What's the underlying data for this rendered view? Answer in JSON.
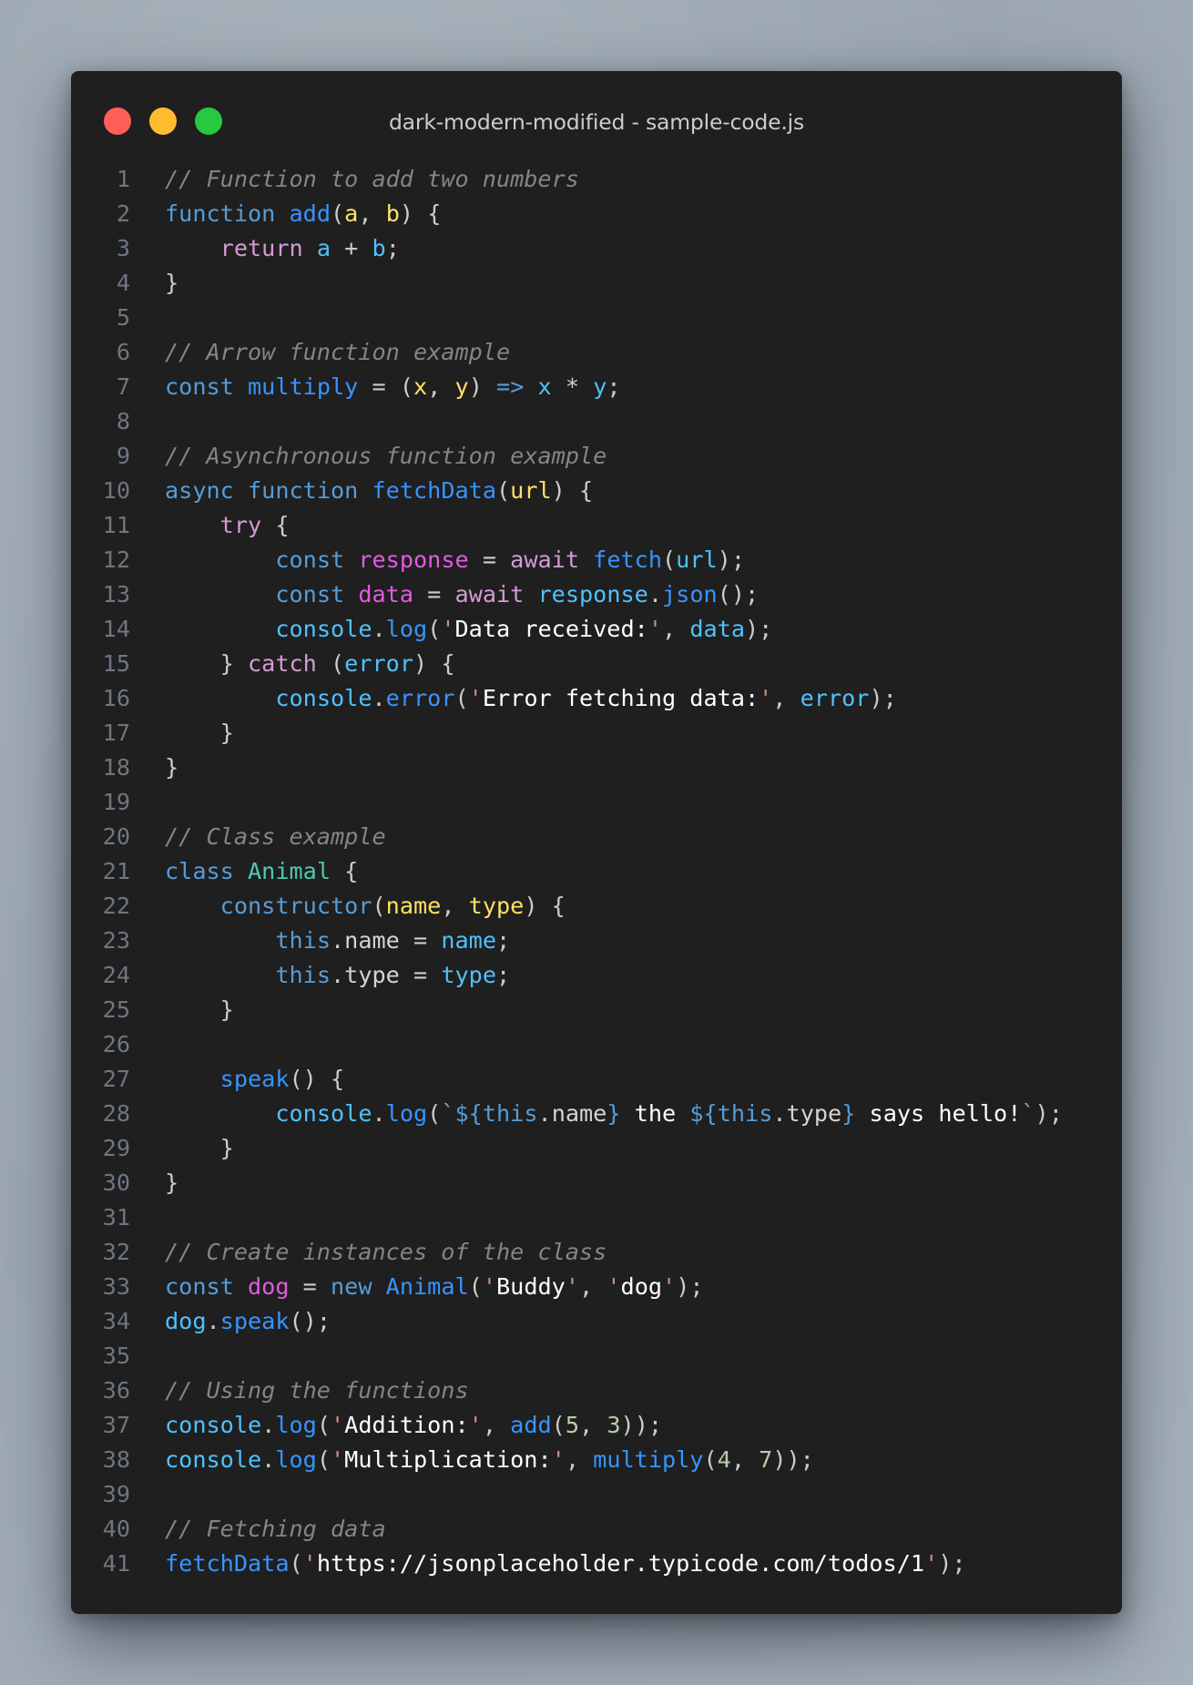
{
  "window": {
    "title": "dark-modern-modified - sample-code.js",
    "controls": [
      {
        "name": "close-button",
        "color": "#ff5f57"
      },
      {
        "name": "minimize-button",
        "color": "#febc2e"
      },
      {
        "name": "maximize-button",
        "color": "#28c840"
      }
    ]
  },
  "editor": {
    "language": "javascript",
    "lines": [
      {
        "n": "1",
        "tokens": [
          [
            "// Function to add two numbers",
            "comment"
          ]
        ]
      },
      {
        "n": "2",
        "tokens": [
          [
            "function",
            "keyword"
          ],
          [
            " ",
            "punct"
          ],
          [
            "add",
            "func"
          ],
          [
            "(",
            "punct"
          ],
          [
            "a",
            "param"
          ],
          [
            ", ",
            "punct"
          ],
          [
            "b",
            "param"
          ],
          [
            ") {",
            "punct"
          ]
        ]
      },
      {
        "n": "3",
        "tokens": [
          [
            "    ",
            "punct"
          ],
          [
            "return",
            "control"
          ],
          [
            " ",
            "punct"
          ],
          [
            "a",
            "var"
          ],
          [
            " + ",
            "punct"
          ],
          [
            "b",
            "var"
          ],
          [
            ";",
            "punct"
          ]
        ]
      },
      {
        "n": "4",
        "tokens": [
          [
            "}",
            "punct"
          ]
        ]
      },
      {
        "n": "5",
        "tokens": []
      },
      {
        "n": "6",
        "tokens": [
          [
            "// Arrow function example",
            "comment"
          ]
        ]
      },
      {
        "n": "7",
        "tokens": [
          [
            "const",
            "keyword"
          ],
          [
            " ",
            "punct"
          ],
          [
            "multiply",
            "func"
          ],
          [
            " = (",
            "punct"
          ],
          [
            "x",
            "param"
          ],
          [
            ", ",
            "punct"
          ],
          [
            "y",
            "param"
          ],
          [
            ") ",
            "punct"
          ],
          [
            "=>",
            "keyword"
          ],
          [
            " ",
            "punct"
          ],
          [
            "x",
            "var"
          ],
          [
            " * ",
            "punct"
          ],
          [
            "y",
            "var"
          ],
          [
            ";",
            "punct"
          ]
        ]
      },
      {
        "n": "8",
        "tokens": []
      },
      {
        "n": "9",
        "tokens": [
          [
            "// Asynchronous function example",
            "comment"
          ]
        ]
      },
      {
        "n": "10",
        "tokens": [
          [
            "async",
            "keyword"
          ],
          [
            " ",
            "punct"
          ],
          [
            "function",
            "keyword"
          ],
          [
            " ",
            "punct"
          ],
          [
            "fetchData",
            "func"
          ],
          [
            "(",
            "punct"
          ],
          [
            "url",
            "param"
          ],
          [
            ") {",
            "punct"
          ]
        ]
      },
      {
        "n": "11",
        "tokens": [
          [
            "    ",
            "punct"
          ],
          [
            "try",
            "control"
          ],
          [
            " {",
            "punct"
          ]
        ]
      },
      {
        "n": "12",
        "tokens": [
          [
            "        ",
            "punct"
          ],
          [
            "const",
            "keyword"
          ],
          [
            " ",
            "punct"
          ],
          [
            "response",
            "decl"
          ],
          [
            " = ",
            "punct"
          ],
          [
            "await",
            "control"
          ],
          [
            " ",
            "punct"
          ],
          [
            "fetch",
            "func"
          ],
          [
            "(",
            "punct"
          ],
          [
            "url",
            "var"
          ],
          [
            ");",
            "punct"
          ]
        ]
      },
      {
        "n": "13",
        "tokens": [
          [
            "        ",
            "punct"
          ],
          [
            "const",
            "keyword"
          ],
          [
            " ",
            "punct"
          ],
          [
            "data",
            "decl"
          ],
          [
            " = ",
            "punct"
          ],
          [
            "await",
            "control"
          ],
          [
            " ",
            "punct"
          ],
          [
            "response",
            "var"
          ],
          [
            ".",
            "punct"
          ],
          [
            "json",
            "func"
          ],
          [
            "();",
            "punct"
          ]
        ]
      },
      {
        "n": "14",
        "tokens": [
          [
            "        ",
            "punct"
          ],
          [
            "console",
            "var"
          ],
          [
            ".",
            "punct"
          ],
          [
            "log",
            "func"
          ],
          [
            "(",
            "punct"
          ],
          [
            "'",
            "quote"
          ],
          [
            "Data received:",
            "string"
          ],
          [
            "'",
            "quote"
          ],
          [
            ", ",
            "punct"
          ],
          [
            "data",
            "var"
          ],
          [
            ");",
            "punct"
          ]
        ]
      },
      {
        "n": "15",
        "tokens": [
          [
            "    } ",
            "punct"
          ],
          [
            "catch",
            "control"
          ],
          [
            " (",
            "punct"
          ],
          [
            "error",
            "var"
          ],
          [
            ") {",
            "punct"
          ]
        ]
      },
      {
        "n": "16",
        "tokens": [
          [
            "        ",
            "punct"
          ],
          [
            "console",
            "var"
          ],
          [
            ".",
            "punct"
          ],
          [
            "error",
            "func"
          ],
          [
            "(",
            "punct"
          ],
          [
            "'",
            "quote"
          ],
          [
            "Error fetching data:",
            "string"
          ],
          [
            "'",
            "quote"
          ],
          [
            ", ",
            "punct"
          ],
          [
            "error",
            "var"
          ],
          [
            ");",
            "punct"
          ]
        ]
      },
      {
        "n": "17",
        "tokens": [
          [
            "    }",
            "punct"
          ]
        ]
      },
      {
        "n": "18",
        "tokens": [
          [
            "}",
            "punct"
          ]
        ]
      },
      {
        "n": "19",
        "tokens": []
      },
      {
        "n": "20",
        "tokens": [
          [
            "// Class example",
            "comment"
          ]
        ]
      },
      {
        "n": "21",
        "tokens": [
          [
            "class",
            "keyword"
          ],
          [
            " ",
            "punct"
          ],
          [
            "Animal",
            "class"
          ],
          [
            " {",
            "punct"
          ]
        ]
      },
      {
        "n": "22",
        "tokens": [
          [
            "    ",
            "punct"
          ],
          [
            "constructor",
            "keyword"
          ],
          [
            "(",
            "punct"
          ],
          [
            "name",
            "param"
          ],
          [
            ", ",
            "punct"
          ],
          [
            "type",
            "param"
          ],
          [
            ") {",
            "punct"
          ]
        ]
      },
      {
        "n": "23",
        "tokens": [
          [
            "        ",
            "punct"
          ],
          [
            "this",
            "keyword"
          ],
          [
            ".",
            "punct"
          ],
          [
            "name",
            "prop"
          ],
          [
            " = ",
            "punct"
          ],
          [
            "name",
            "var"
          ],
          [
            ";",
            "punct"
          ]
        ]
      },
      {
        "n": "24",
        "tokens": [
          [
            "        ",
            "punct"
          ],
          [
            "this",
            "keyword"
          ],
          [
            ".",
            "punct"
          ],
          [
            "type",
            "prop"
          ],
          [
            " = ",
            "punct"
          ],
          [
            "type",
            "var"
          ],
          [
            ";",
            "punct"
          ]
        ]
      },
      {
        "n": "25",
        "tokens": [
          [
            "    }",
            "punct"
          ]
        ]
      },
      {
        "n": "26",
        "tokens": []
      },
      {
        "n": "27",
        "tokens": [
          [
            "    ",
            "punct"
          ],
          [
            "speak",
            "func"
          ],
          [
            "() {",
            "punct"
          ]
        ]
      },
      {
        "n": "28",
        "tokens": [
          [
            "        ",
            "punct"
          ],
          [
            "console",
            "var"
          ],
          [
            ".",
            "punct"
          ],
          [
            "log",
            "func"
          ],
          [
            "(",
            "punct"
          ],
          [
            "`",
            "quote"
          ],
          [
            "${",
            "interp"
          ],
          [
            "this",
            "keyword"
          ],
          [
            ".",
            "punct"
          ],
          [
            "name",
            "prop"
          ],
          [
            "}",
            "interp"
          ],
          [
            " the ",
            "string"
          ],
          [
            "${",
            "interp"
          ],
          [
            "this",
            "keyword"
          ],
          [
            ".",
            "punct"
          ],
          [
            "type",
            "prop"
          ],
          [
            "}",
            "interp"
          ],
          [
            " says hello!",
            "string"
          ],
          [
            "`",
            "quote"
          ],
          [
            ");",
            "punct"
          ]
        ]
      },
      {
        "n": "29",
        "tokens": [
          [
            "    }",
            "punct"
          ]
        ]
      },
      {
        "n": "30",
        "tokens": [
          [
            "}",
            "punct"
          ]
        ]
      },
      {
        "n": "31",
        "tokens": []
      },
      {
        "n": "32",
        "tokens": [
          [
            "// Create instances of the class",
            "comment"
          ]
        ]
      },
      {
        "n": "33",
        "tokens": [
          [
            "const",
            "keyword"
          ],
          [
            " ",
            "punct"
          ],
          [
            "dog",
            "decl"
          ],
          [
            " = ",
            "punct"
          ],
          [
            "new",
            "keyword"
          ],
          [
            " ",
            "punct"
          ],
          [
            "Animal",
            "func"
          ],
          [
            "(",
            "punct"
          ],
          [
            "'",
            "quote"
          ],
          [
            "Buddy",
            "string"
          ],
          [
            "'",
            "quote"
          ],
          [
            ", ",
            "punct"
          ],
          [
            "'",
            "quote"
          ],
          [
            "dog",
            "string"
          ],
          [
            "'",
            "quote"
          ],
          [
            ");",
            "punct"
          ]
        ]
      },
      {
        "n": "34",
        "tokens": [
          [
            "dog",
            "var"
          ],
          [
            ".",
            "punct"
          ],
          [
            "speak",
            "func"
          ],
          [
            "();",
            "punct"
          ]
        ]
      },
      {
        "n": "35",
        "tokens": []
      },
      {
        "n": "36",
        "tokens": [
          [
            "// Using the functions",
            "comment"
          ]
        ]
      },
      {
        "n": "37",
        "tokens": [
          [
            "console",
            "var"
          ],
          [
            ".",
            "punct"
          ],
          [
            "log",
            "func"
          ],
          [
            "(",
            "punct"
          ],
          [
            "'",
            "quote"
          ],
          [
            "Addition:",
            "string"
          ],
          [
            "'",
            "quote"
          ],
          [
            ", ",
            "punct"
          ],
          [
            "add",
            "func"
          ],
          [
            "(",
            "punct"
          ],
          [
            "5",
            "number"
          ],
          [
            ", ",
            "punct"
          ],
          [
            "3",
            "number"
          ],
          [
            "));",
            "punct"
          ]
        ]
      },
      {
        "n": "38",
        "tokens": [
          [
            "console",
            "var"
          ],
          [
            ".",
            "punct"
          ],
          [
            "log",
            "func"
          ],
          [
            "(",
            "punct"
          ],
          [
            "'",
            "quote"
          ],
          [
            "Multiplication:",
            "string"
          ],
          [
            "'",
            "quote"
          ],
          [
            ", ",
            "punct"
          ],
          [
            "multiply",
            "func"
          ],
          [
            "(",
            "punct"
          ],
          [
            "4",
            "number"
          ],
          [
            ", ",
            "punct"
          ],
          [
            "7",
            "number"
          ],
          [
            "));",
            "punct"
          ]
        ]
      },
      {
        "n": "39",
        "tokens": []
      },
      {
        "n": "40",
        "tokens": [
          [
            "// Fetching data",
            "comment"
          ]
        ]
      },
      {
        "n": "41",
        "tokens": [
          [
            "fetchData",
            "func"
          ],
          [
            "(",
            "punct"
          ],
          [
            "'",
            "quote"
          ],
          [
            "https://jsonplaceholder.typicode.com/todos/1",
            "string"
          ],
          [
            "'",
            "quote"
          ],
          [
            ");",
            "punct"
          ]
        ]
      }
    ]
  }
}
